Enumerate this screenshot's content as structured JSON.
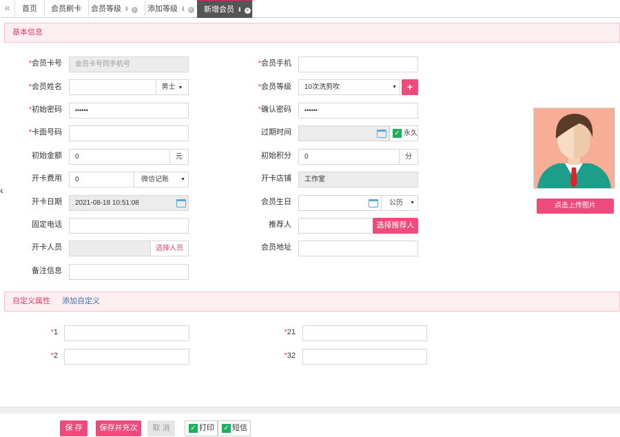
{
  "tabs": {
    "back": "«",
    "items": [
      {
        "label": "首页"
      },
      {
        "label": "会员刷卡"
      },
      {
        "label": "会员等级"
      },
      {
        "label": "添加等级"
      },
      {
        "label": "新增会员"
      }
    ],
    "pin": "⬇",
    "close": "×"
  },
  "section_basic": {
    "title": "基本信息"
  },
  "form": {
    "card_no": {
      "label": "会员卡号",
      "placeholder": "会员卡号同手机号"
    },
    "mobile": {
      "label": "会员手机",
      "value": ""
    },
    "name": {
      "label": "会员姓名",
      "value": ""
    },
    "gender": {
      "value": "男士"
    },
    "level": {
      "label": "会员等级",
      "value": "10次洗剪吹"
    },
    "init_password": {
      "label": "初始密码",
      "value": "••••••"
    },
    "confirm_password": {
      "label": "确认密码",
      "value": "••••••"
    },
    "face_no": {
      "label": "卡面号码",
      "value": ""
    },
    "expire": {
      "label": "过期时间",
      "value": "",
      "permanent_label": "永久"
    },
    "init_amount": {
      "label": "初始金额",
      "value": "0",
      "unit": "元"
    },
    "init_points": {
      "label": "初始积分",
      "value": "0",
      "unit": "分"
    },
    "card_fee": {
      "label": "开卡费用",
      "value": "0",
      "pay_method": "微信记账"
    },
    "store": {
      "label": "开卡店铺",
      "value": "工作室"
    },
    "open_date": {
      "label": "开卡日期",
      "value": "2021-08-18 10:51:08"
    },
    "birthday": {
      "label": "会员生日",
      "value": "",
      "calendar": "公历"
    },
    "phone": {
      "label": "固定电话",
      "value": ""
    },
    "referrer": {
      "label": "推荐人",
      "value": "",
      "button": "选择推荐人"
    },
    "staff": {
      "label": "开卡人员",
      "value": "",
      "button": "选择人员"
    },
    "address": {
      "label": "会员地址",
      "value": ""
    },
    "remark": {
      "label": "备注信息",
      "value": ""
    }
  },
  "avatar": {
    "upload_button": "点击上传图片"
  },
  "section_custom": {
    "title": "自定义属性",
    "add_link": "添加自定义"
  },
  "custom_fields": [
    {
      "label": "1",
      "value": ""
    },
    {
      "label": "21",
      "value": ""
    },
    {
      "label": "2",
      "value": ""
    },
    {
      "label": "32",
      "value": ""
    }
  ],
  "footer": {
    "save": "保 存",
    "save_recharge": "保存并充次",
    "cancel": "取 消",
    "print": "打印",
    "sms": "短信"
  },
  "colors": {
    "accent": "#ee4a7c",
    "check": "#1fae5c"
  }
}
